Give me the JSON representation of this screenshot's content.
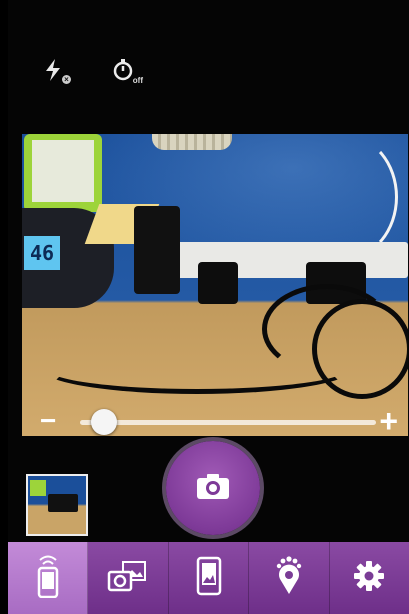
{
  "top_controls": {
    "flash_icon": "flash-off-icon",
    "timer_icon": "self-timer-icon",
    "timer_sub": "off"
  },
  "preview": {
    "clock_display": "46"
  },
  "zoom": {
    "minus_label": "−",
    "plus_label": "+",
    "level": 0.08
  },
  "shutter": {
    "icon": "camera-icon"
  },
  "bottom_nav": {
    "items": [
      {
        "name": "wireless-device-icon",
        "active": true
      },
      {
        "name": "photo-gallery-icon",
        "active": false
      },
      {
        "name": "phone-image-icon",
        "active": false
      },
      {
        "name": "location-pin-icon",
        "active": false
      },
      {
        "name": "gear-icon",
        "active": false
      }
    ]
  },
  "colors": {
    "accent": "#7e3a98",
    "nav_active": "#b77ccf",
    "nav_bg": "#7a3c96"
  }
}
